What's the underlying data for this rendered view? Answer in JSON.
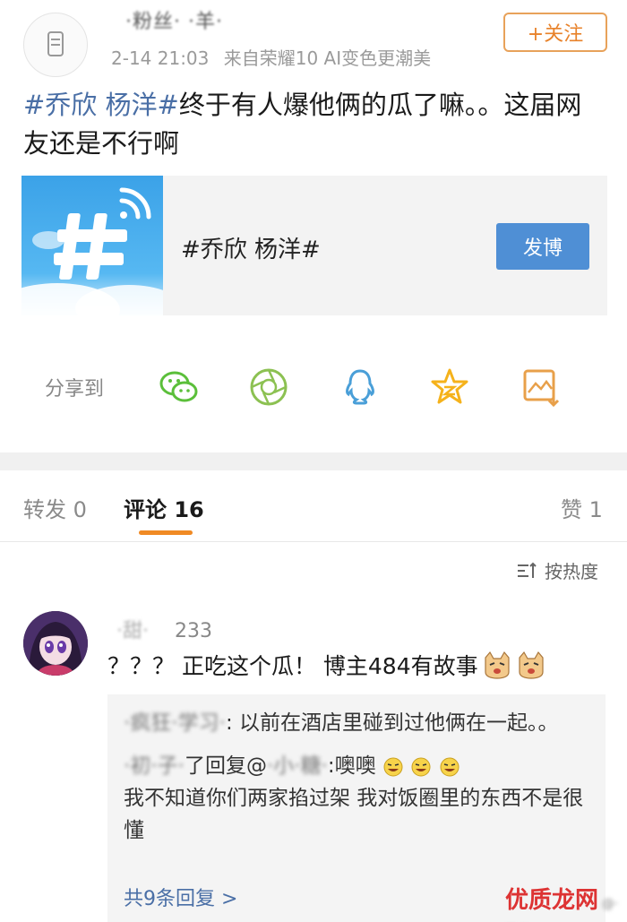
{
  "post": {
    "username": "·粉丝·  ·羊·",
    "timestamp": "2-14 21:03",
    "source": "来自荣耀10 AI变色更潮美",
    "follow_label": "+关注",
    "tag_text": "#乔欣 杨洋#",
    "body_text": "终于有人爆他俩的瓜了嘛。。这届网友还是不行啊"
  },
  "card": {
    "title": "#乔欣 杨洋#",
    "button_label": "发博"
  },
  "share": {
    "label": "分享到",
    "icons": [
      "wechat-icon",
      "moments-icon",
      "qq-icon",
      "qzone-icon",
      "save-image-icon"
    ]
  },
  "tabs": {
    "repost": "转发 0",
    "comments": "评论 16",
    "likes": "赞 1"
  },
  "sort": {
    "label": "按热度"
  },
  "comment": {
    "username_blurred": "·甜·",
    "username_suffix": "233",
    "text": "？？？ 正吃这个瓜！ 博主484有故事",
    "replies": [
      {
        "author": "·疯狂·学习·",
        "text": ": 以前在酒店里碰到过他俩在一起。。"
      },
      {
        "author": "·初·子·",
        "action": "了回复@",
        "target": "·小·糖·",
        "text": ":噢噢"
      },
      {
        "text": "我不知道你们两家掐过架  我对饭圈里的东西不是很懂"
      }
    ],
    "more_replies": "共9条回复 >"
  },
  "watermark": {
    "text": "优质龙网",
    "sub": "@·粉丝·"
  },
  "colors": {
    "link": "#4a6fa6",
    "accent": "#f08a24",
    "button": "#4f8fd5"
  }
}
